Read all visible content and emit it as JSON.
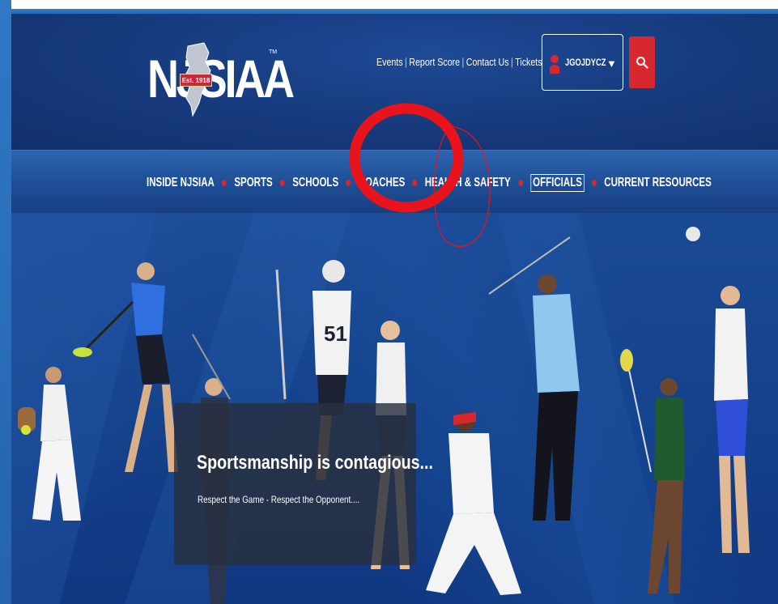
{
  "brand": {
    "logo_text": "NJSIAA",
    "logo_est": "Est. 1918",
    "logo_tm": "TM"
  },
  "utility_links": [
    {
      "label": "Events"
    },
    {
      "label": "Report Score"
    },
    {
      "label": "Contact Us"
    },
    {
      "label": "Tickets"
    }
  ],
  "utility_separator": "|",
  "user": {
    "name": "JGOJDYCZ",
    "caret": "▼"
  },
  "search": {
    "icon": "search-icon"
  },
  "nav": {
    "items": [
      {
        "label": "INSIDE NJSIAA"
      },
      {
        "label": "SPORTS"
      },
      {
        "label": "SCHOOLS"
      },
      {
        "label": "COACHES"
      },
      {
        "label": "HEALTH & SAFETY"
      },
      {
        "label": "OFFICIALS"
      },
      {
        "label": "CURRENT RESOURCES"
      }
    ],
    "active": "OFFICIALS"
  },
  "hero": {
    "title": "Sportsmanship is contagious...",
    "subtitle": "Respect the Game - Respect the Opponent...."
  },
  "colors": {
    "accent_red": "#d7282f",
    "header_blue": "#173c80",
    "annotation_red": "#e8131b"
  }
}
